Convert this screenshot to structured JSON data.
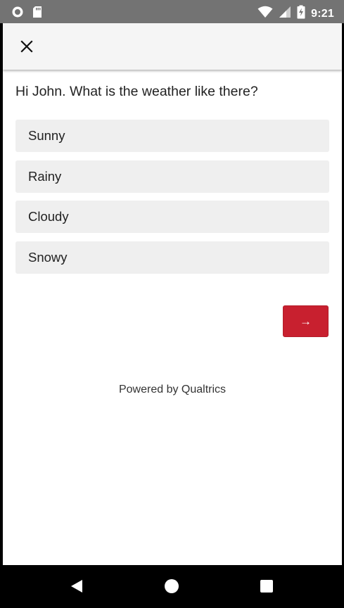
{
  "status_bar": {
    "time": "9:21",
    "icons": [
      "circle-notification-icon",
      "sd-card-icon",
      "wifi-icon",
      "signal-icon",
      "battery-charging-icon"
    ]
  },
  "header": {
    "close_icon": "close-icon"
  },
  "survey": {
    "question": "Hi John. What is the weather like there?",
    "choices": [
      "Sunny",
      "Rainy",
      "Cloudy",
      "Snowy"
    ],
    "next_label": "→",
    "footer": "Powered by Qualtrics",
    "accent_color": "#c8202f"
  },
  "nav_bar": {
    "icons": [
      "back-icon",
      "home-icon",
      "recents-icon"
    ]
  }
}
